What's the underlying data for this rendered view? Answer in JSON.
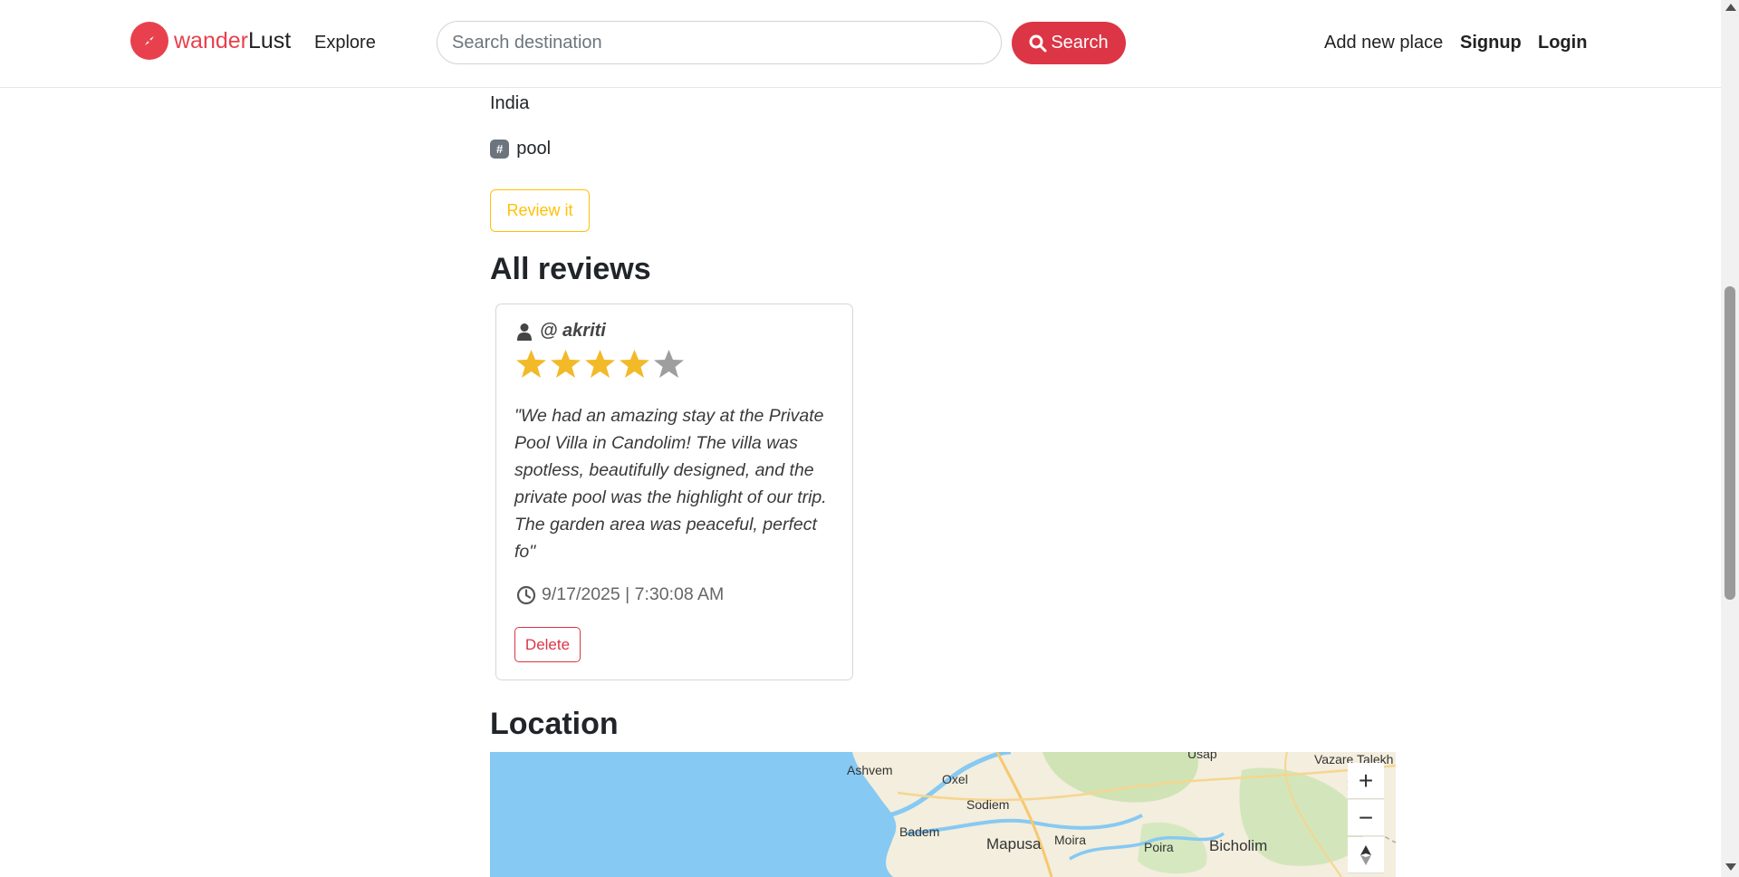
{
  "navbar": {
    "brand_part1": "wander",
    "brand_part2": "Lust",
    "explore": "Explore",
    "search_placeholder": "Search destination",
    "search_button": "Search",
    "add_place": "Add new place",
    "signup": "Signup",
    "login": "Login"
  },
  "listing": {
    "country": "India",
    "tag_badge": "#",
    "tag": "pool",
    "review_button": "Review it"
  },
  "reviews": {
    "heading": "All reviews",
    "items": [
      {
        "author": "@ akriti",
        "rating": 4,
        "rating_max": 5,
        "text": "\"We had an amazing stay at the Private Pool Villa in Candolim! The villa was spotless, beautifully designed, and the private pool was the highlight of our trip. The garden area was peaceful, perfect fo\"",
        "timestamp": "9/17/2025 | 7:30:08 AM",
        "delete_label": "Delete"
      }
    ]
  },
  "location": {
    "heading": "Location",
    "map_labels": [
      "Ashvem",
      "Oxel",
      "Sodiem",
      "Badem",
      "Mapusa",
      "Moira",
      "Poira",
      "Bicholim",
      "Usap",
      "Vazare Talekh"
    ],
    "zoom_in": "+",
    "zoom_out": "−"
  },
  "colors": {
    "brand": "#e8414d",
    "primary_danger": "#dc3545",
    "warning": "#ffc107",
    "star_filled": "#f2b928",
    "star_empty": "#9e9e9e",
    "sea": "#86c9f3"
  }
}
